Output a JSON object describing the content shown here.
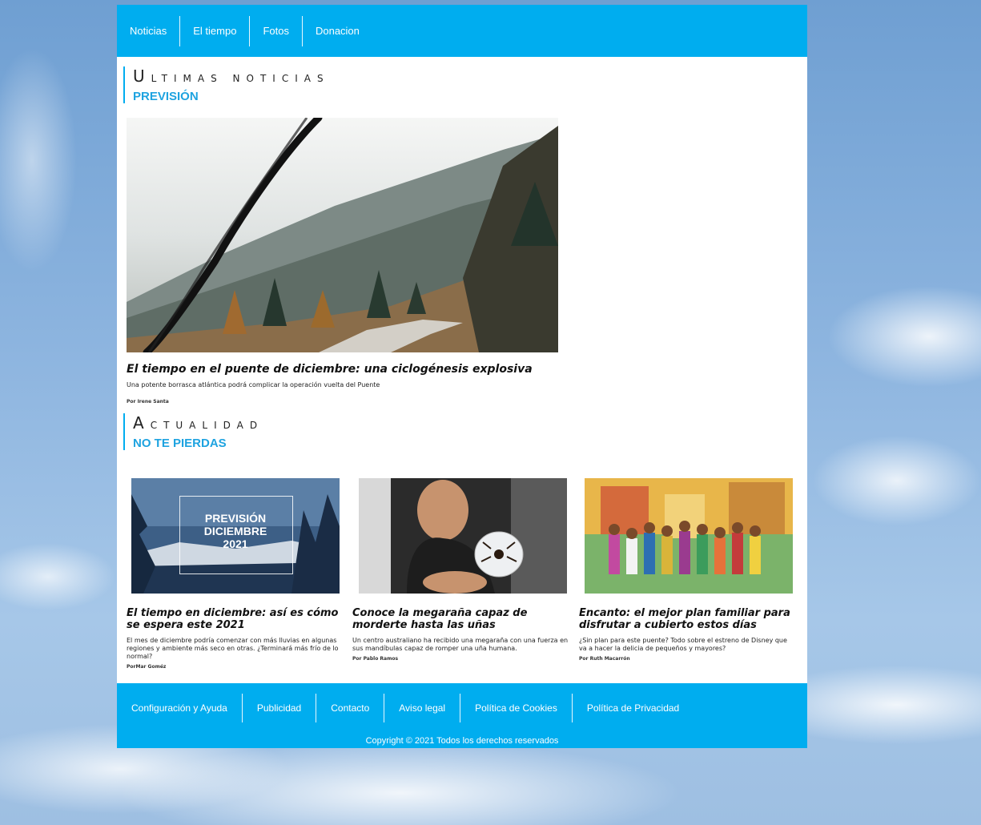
{
  "nav": {
    "items": [
      "Noticias",
      "El tiempo",
      "Fotos",
      "Donacion"
    ]
  },
  "latest": {
    "heading": "Ultimas noticias",
    "subheading": "PREVISIÓN",
    "headline": "El tiempo en el puente de diciembre: una ciclogénesis explosiva",
    "summary": "Una potente borrasca atlántica podrá complicar la operación vuelta del Puente",
    "author": "Por Irene Santa"
  },
  "actualidad": {
    "heading": "Actualidad",
    "subheading": "NO TE PIERDAS",
    "cards": [
      {
        "image_text_1": "PREVISIÓN",
        "image_text_2": "DICIEMBRE",
        "image_text_3": "2021",
        "title": "El tiempo en diciembre: así es cómo se espera este 2021",
        "summary": "El mes de diciembre podría comenzar con más lluvias en algunas regiones y ambiente más seco en otras. ¿Terminará más frío de lo normal?",
        "author": "PorMar Goméz"
      },
      {
        "title": "Conoce la megaraña capaz de morderte hasta las uñas",
        "summary": "Un centro australiano ha recibido una megaraña con una fuerza en sus mandíbulas capaz de romper una uña humana.",
        "author": "Por Pablo Ramos"
      },
      {
        "title": "Encanto: el mejor plan familiar para disfrutar a cubierto estos días",
        "summary": "¿Sin plan para este puente? Todo sobre el estreno de Disney que va a hacer la delicia de pequeños y mayores?",
        "author": "Por Ruth Macarrón"
      }
    ]
  },
  "footer": {
    "links": [
      "Configuración y Ayuda",
      "Publicidad",
      "Contacto",
      "Aviso legal",
      "Política de Cookies",
      "Política de Privacidad"
    ],
    "copyright": "Copyright © 2021 Todos los derechos reservados"
  },
  "colors": {
    "accent": "#00adef",
    "subheading": "#1ea3e0"
  }
}
